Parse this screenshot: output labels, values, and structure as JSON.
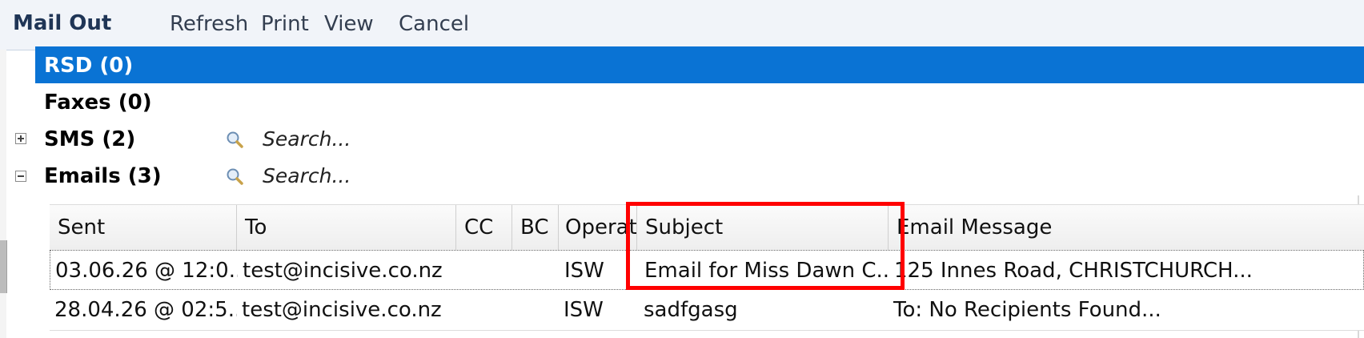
{
  "toolbar": {
    "title": "Mail Out",
    "buttons": [
      "Refresh",
      "Print",
      "View",
      "Cancel"
    ]
  },
  "groups": [
    {
      "label": "RSD (0)",
      "selected": true
    },
    {
      "label": "Faxes (0)"
    },
    {
      "label": "SMS (2)",
      "expander": "plus-icon",
      "search_placeholder": "Search..."
    },
    {
      "label": "Emails (3)",
      "expander": "minus-icon",
      "search_placeholder": "Search..."
    }
  ],
  "grid": {
    "columns": [
      "Sent",
      "To",
      "CC",
      "BC",
      "Operator",
      "Subject",
      "Email Message"
    ],
    "rows": [
      {
        "sent": "03.06.26 @ 12:0...",
        "to": "test@incisive.co.nz",
        "cc": "",
        "bc": "",
        "operator": "ISW",
        "subject": "Email for Miss Dawn C...",
        "message": "125 Innes Road, CHRISTCHURCH..."
      },
      {
        "sent": "28.04.26 @ 02:5...",
        "to": "test@incisive.co.nz",
        "cc": "",
        "bc": "",
        "operator": "ISW",
        "subject": "sadfgasg",
        "message": "To: No Recipients Found..."
      }
    ]
  },
  "colors": {
    "selected_group": "#0a73d4",
    "highlight": "#ff0000",
    "title": "#1f3556"
  }
}
